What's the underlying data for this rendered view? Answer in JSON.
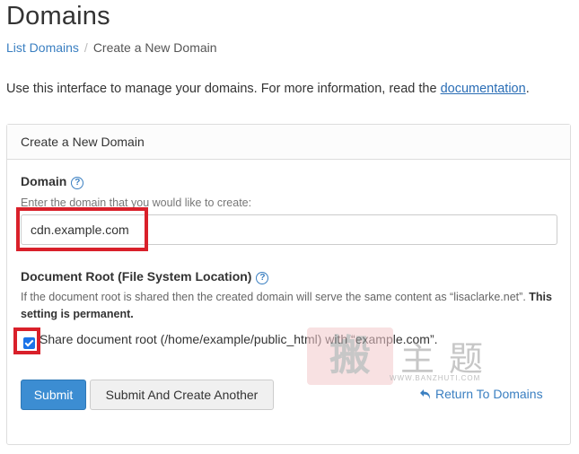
{
  "page": {
    "title": "Domains"
  },
  "breadcrumb": {
    "items": [
      {
        "label": "List Domains"
      },
      {
        "label": "Create a New Domain"
      }
    ],
    "separator": "/"
  },
  "intro": {
    "text_before": "Use this interface to manage your domains. For more information, read the ",
    "link_label": "documentation",
    "text_after": "."
  },
  "panel": {
    "heading": "Create a New Domain",
    "domain": {
      "label": "Domain",
      "help_icon": "question-circle-icon",
      "hint": "Enter the domain that you would like to create:",
      "value": "cdn.example.com"
    },
    "document_root": {
      "label": "Document Root (File System Location)",
      "help_icon": "question-circle-icon",
      "description": "If the document root is shared then the created domain will serve the same content as “lisaclarke.net”.",
      "description_bold": "This setting is permanent.",
      "share_checked": true,
      "share_label": "Share document root (/home/example/public_html) with “example.com”."
    },
    "buttons": {
      "submit_label": "Submit",
      "submit_another_label": "Submit And Create Another"
    },
    "return_link": {
      "icon": "undo-arrow-icon",
      "label": "Return To Domains"
    }
  },
  "watermark": {
    "stamp_char": "搬",
    "text": "主题",
    "url": "WWW.BANZHUTI.COM"
  },
  "colors": {
    "accent": "#3c8dd2",
    "link": "#3a7fc1",
    "highlight_border": "#d9202a"
  }
}
